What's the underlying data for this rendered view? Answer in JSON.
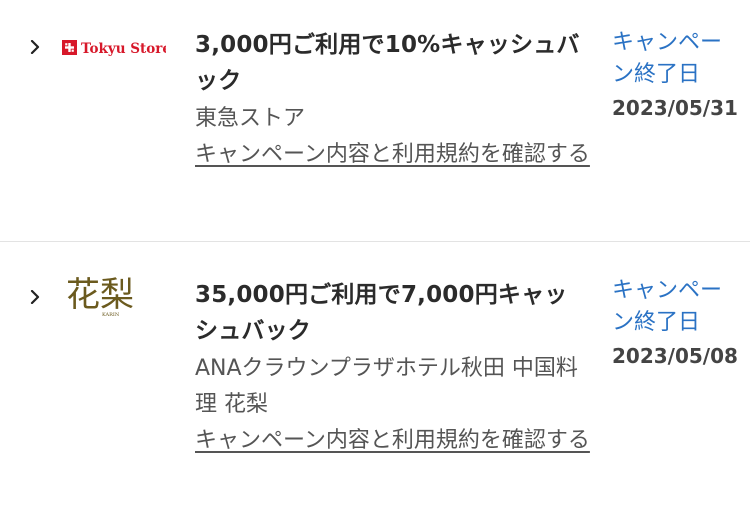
{
  "campaigns": [
    {
      "logo_text": "Tokyu Store",
      "title": "3,000円ご利用で10%キャッシュバック",
      "store": "東急ストア",
      "terms_link": "キャンペーン内容と利用規約を確認する",
      "end_label": "キャンペーン終了日",
      "end_date": "2023/05/31"
    },
    {
      "logo_text": "花梨",
      "logo_subtext": "KARIN",
      "title": "35,000円ご利用で7,000円キャッシュバック",
      "store": "ANAクラウンプラザホテル秋田 中国料理 花梨",
      "terms_link": "キャンペーン内容と利用規約を確認する",
      "end_label": "キャンペーン終了日",
      "end_date": "2023/05/08"
    }
  ],
  "colors": {
    "link_blue": "#2a72c4",
    "tokyu_red": "#d7182a",
    "karin_olive": "#6b5a1e",
    "divider": "#e3e3e3"
  }
}
